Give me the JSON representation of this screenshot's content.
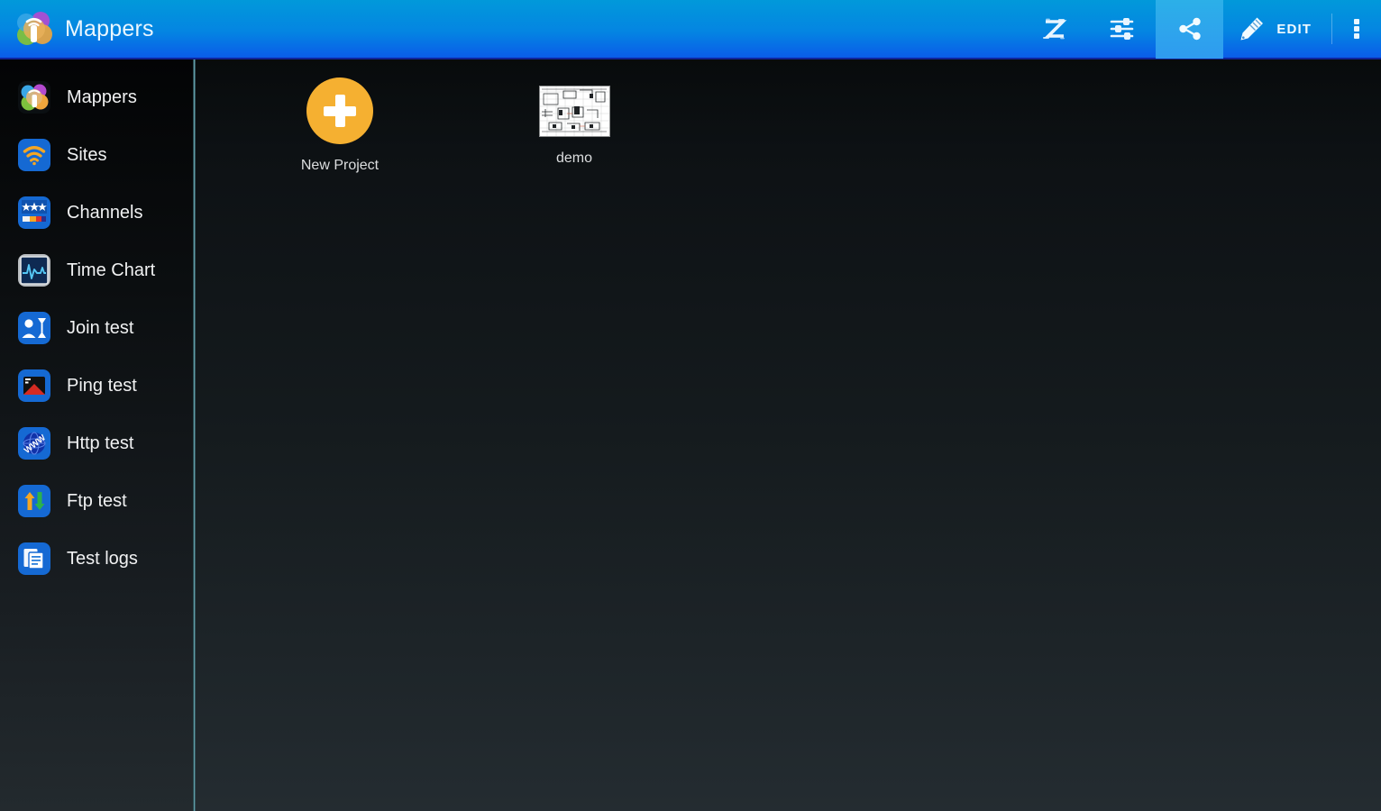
{
  "app": {
    "title": "Mappers",
    "logo_icon": "mappers-logo-icon",
    "accent_blue": "#0485e2",
    "accent_orange": "#f5b031",
    "divider_teal": "#6fb0b8"
  },
  "header": {
    "actions": [
      {
        "name": "zoiper-z-button",
        "icon": "z-logo-icon",
        "label": "",
        "active": false
      },
      {
        "name": "tune-button",
        "icon": "tune-sliders-icon",
        "label": "",
        "active": false
      },
      {
        "name": "share-button",
        "icon": "share-icon",
        "label": "",
        "active": true
      },
      {
        "name": "edit-button",
        "icon": "pencil-edit-icon",
        "label": "EDIT",
        "active": false
      },
      {
        "name": "overflow-button",
        "icon": "more-vertical-icon",
        "label": "",
        "active": false
      }
    ]
  },
  "sidebar": {
    "items": [
      {
        "label": "Mappers",
        "icon": "mappers-logo-icon"
      },
      {
        "label": "Sites",
        "icon": "wifi-signal-icon"
      },
      {
        "label": "Channels",
        "icon": "channels-stars-icon"
      },
      {
        "label": "Time Chart",
        "icon": "time-chart-icon"
      },
      {
        "label": "Join test",
        "icon": "join-test-icon"
      },
      {
        "label": "Ping test",
        "icon": "ping-test-icon"
      },
      {
        "label": "Http test",
        "icon": "http-test-www-icon"
      },
      {
        "label": "Ftp test",
        "icon": "ftp-transfer-arrows-icon"
      },
      {
        "label": "Test logs",
        "icon": "test-logs-documents-icon"
      }
    ]
  },
  "main": {
    "projects": [
      {
        "label": "New Project",
        "type": "new"
      },
      {
        "label": "demo",
        "type": "thumbnail"
      }
    ]
  }
}
